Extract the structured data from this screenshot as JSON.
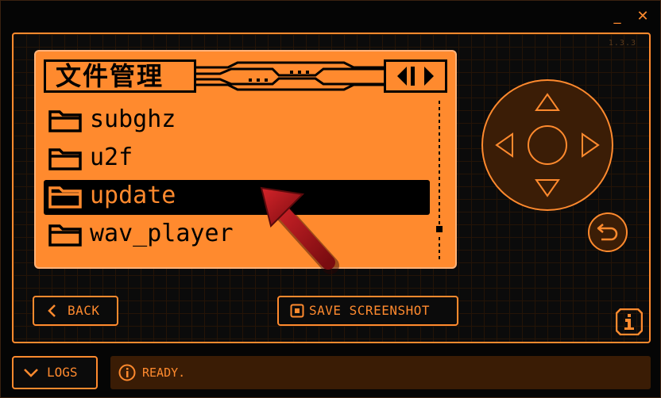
{
  "titlebar": {
    "minimize_label": "_",
    "close_label": "✕"
  },
  "app": {
    "version": "1.3.3"
  },
  "screen": {
    "header_title": "文件管理",
    "nav_icon": "left-right-arrows-icon",
    "files": [
      {
        "name": "subghz",
        "icon": "folder-icon",
        "selected": false
      },
      {
        "name": "u2f",
        "icon": "folder-icon",
        "selected": false
      },
      {
        "name": "update",
        "icon": "folder-icon",
        "selected": true
      },
      {
        "name": "wav_player",
        "icon": "folder-icon",
        "selected": false
      }
    ],
    "scroll_position": 0.82
  },
  "controls": {
    "dpad_icons": [
      "up-arrow-icon",
      "left-arrow-icon",
      "ok-circle-icon",
      "right-arrow-icon",
      "down-arrow-icon"
    ],
    "back_icon": "undo-icon"
  },
  "buttons": {
    "back_label": "BACK",
    "save_label": "SAVE SCREENSHOT",
    "info_icon": "info-icon"
  },
  "footer": {
    "logs_label": "LOGS",
    "status_text": "READY."
  },
  "colors": {
    "accent": "#ff8a2e",
    "screen_bg": "#ff8a2e",
    "panel_bg": "#0b0b0b",
    "status_bg": "#3a1c05",
    "highlight_arrow": "#b3141a"
  }
}
